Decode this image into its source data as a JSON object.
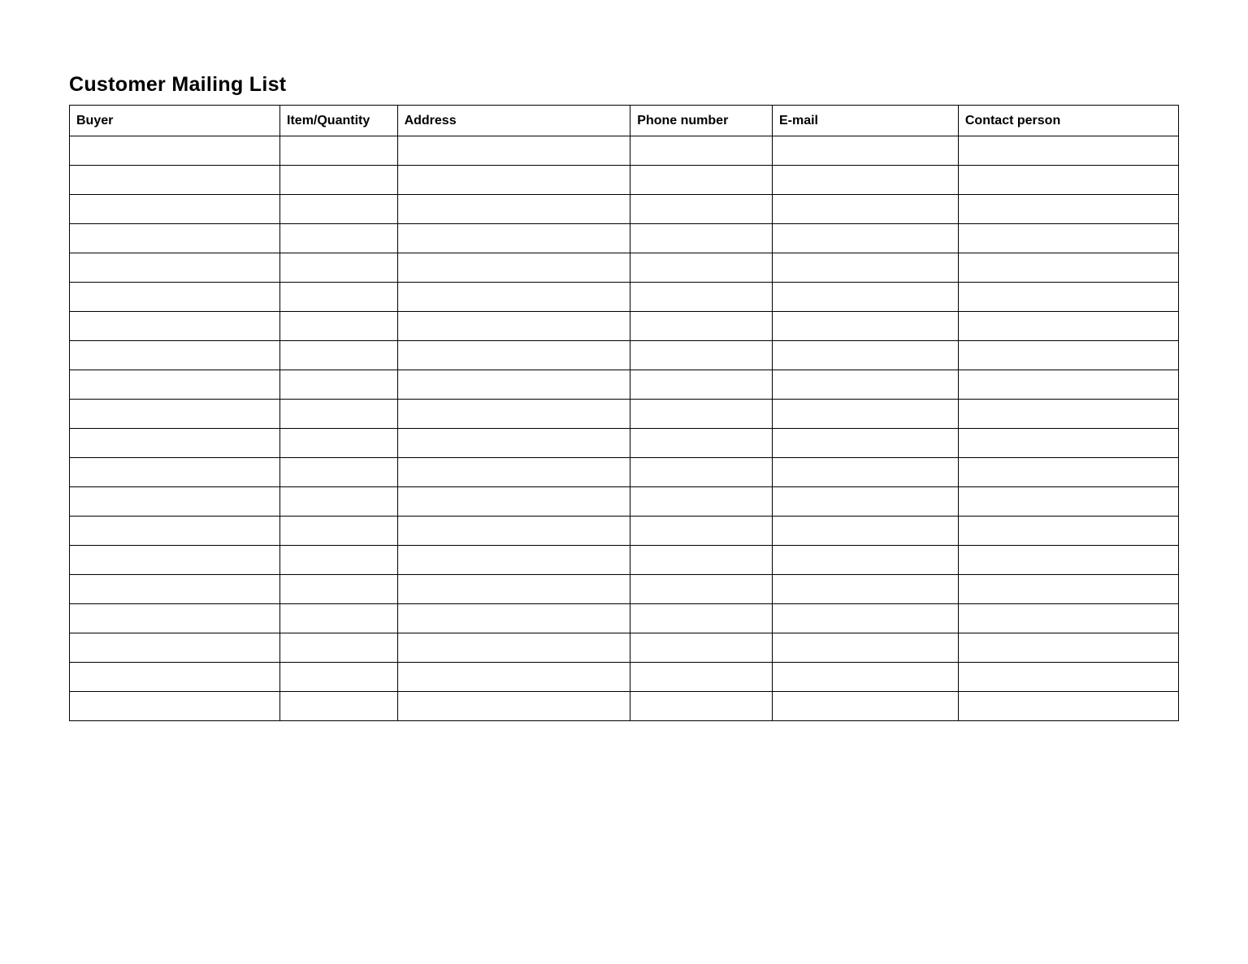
{
  "title": "Customer Mailing List",
  "columns": {
    "buyer": "Buyer",
    "item": "Item/Quantity",
    "address": "Address",
    "phone": "Phone number",
    "email": "E-mail",
    "contact": "Contact person"
  },
  "rows": [
    {
      "buyer": "",
      "item": "",
      "address": "",
      "phone": "",
      "email": "",
      "contact": ""
    },
    {
      "buyer": "",
      "item": "",
      "address": "",
      "phone": "",
      "email": "",
      "contact": ""
    },
    {
      "buyer": "",
      "item": "",
      "address": "",
      "phone": "",
      "email": "",
      "contact": ""
    },
    {
      "buyer": "",
      "item": "",
      "address": "",
      "phone": "",
      "email": "",
      "contact": ""
    },
    {
      "buyer": "",
      "item": "",
      "address": "",
      "phone": "",
      "email": "",
      "contact": ""
    },
    {
      "buyer": "",
      "item": "",
      "address": "",
      "phone": "",
      "email": "",
      "contact": ""
    },
    {
      "buyer": "",
      "item": "",
      "address": "",
      "phone": "",
      "email": "",
      "contact": ""
    },
    {
      "buyer": "",
      "item": "",
      "address": "",
      "phone": "",
      "email": "",
      "contact": ""
    },
    {
      "buyer": "",
      "item": "",
      "address": "",
      "phone": "",
      "email": "",
      "contact": ""
    },
    {
      "buyer": "",
      "item": "",
      "address": "",
      "phone": "",
      "email": "",
      "contact": ""
    },
    {
      "buyer": "",
      "item": "",
      "address": "",
      "phone": "",
      "email": "",
      "contact": ""
    },
    {
      "buyer": "",
      "item": "",
      "address": "",
      "phone": "",
      "email": "",
      "contact": ""
    },
    {
      "buyer": "",
      "item": "",
      "address": "",
      "phone": "",
      "email": "",
      "contact": ""
    },
    {
      "buyer": "",
      "item": "",
      "address": "",
      "phone": "",
      "email": "",
      "contact": ""
    },
    {
      "buyer": "",
      "item": "",
      "address": "",
      "phone": "",
      "email": "",
      "contact": ""
    },
    {
      "buyer": "",
      "item": "",
      "address": "",
      "phone": "",
      "email": "",
      "contact": ""
    },
    {
      "buyer": "",
      "item": "",
      "address": "",
      "phone": "",
      "email": "",
      "contact": ""
    },
    {
      "buyer": "",
      "item": "",
      "address": "",
      "phone": "",
      "email": "",
      "contact": ""
    },
    {
      "buyer": "",
      "item": "",
      "address": "",
      "phone": "",
      "email": "",
      "contact": ""
    },
    {
      "buyer": "",
      "item": "",
      "address": "",
      "phone": "",
      "email": "",
      "contact": ""
    }
  ]
}
